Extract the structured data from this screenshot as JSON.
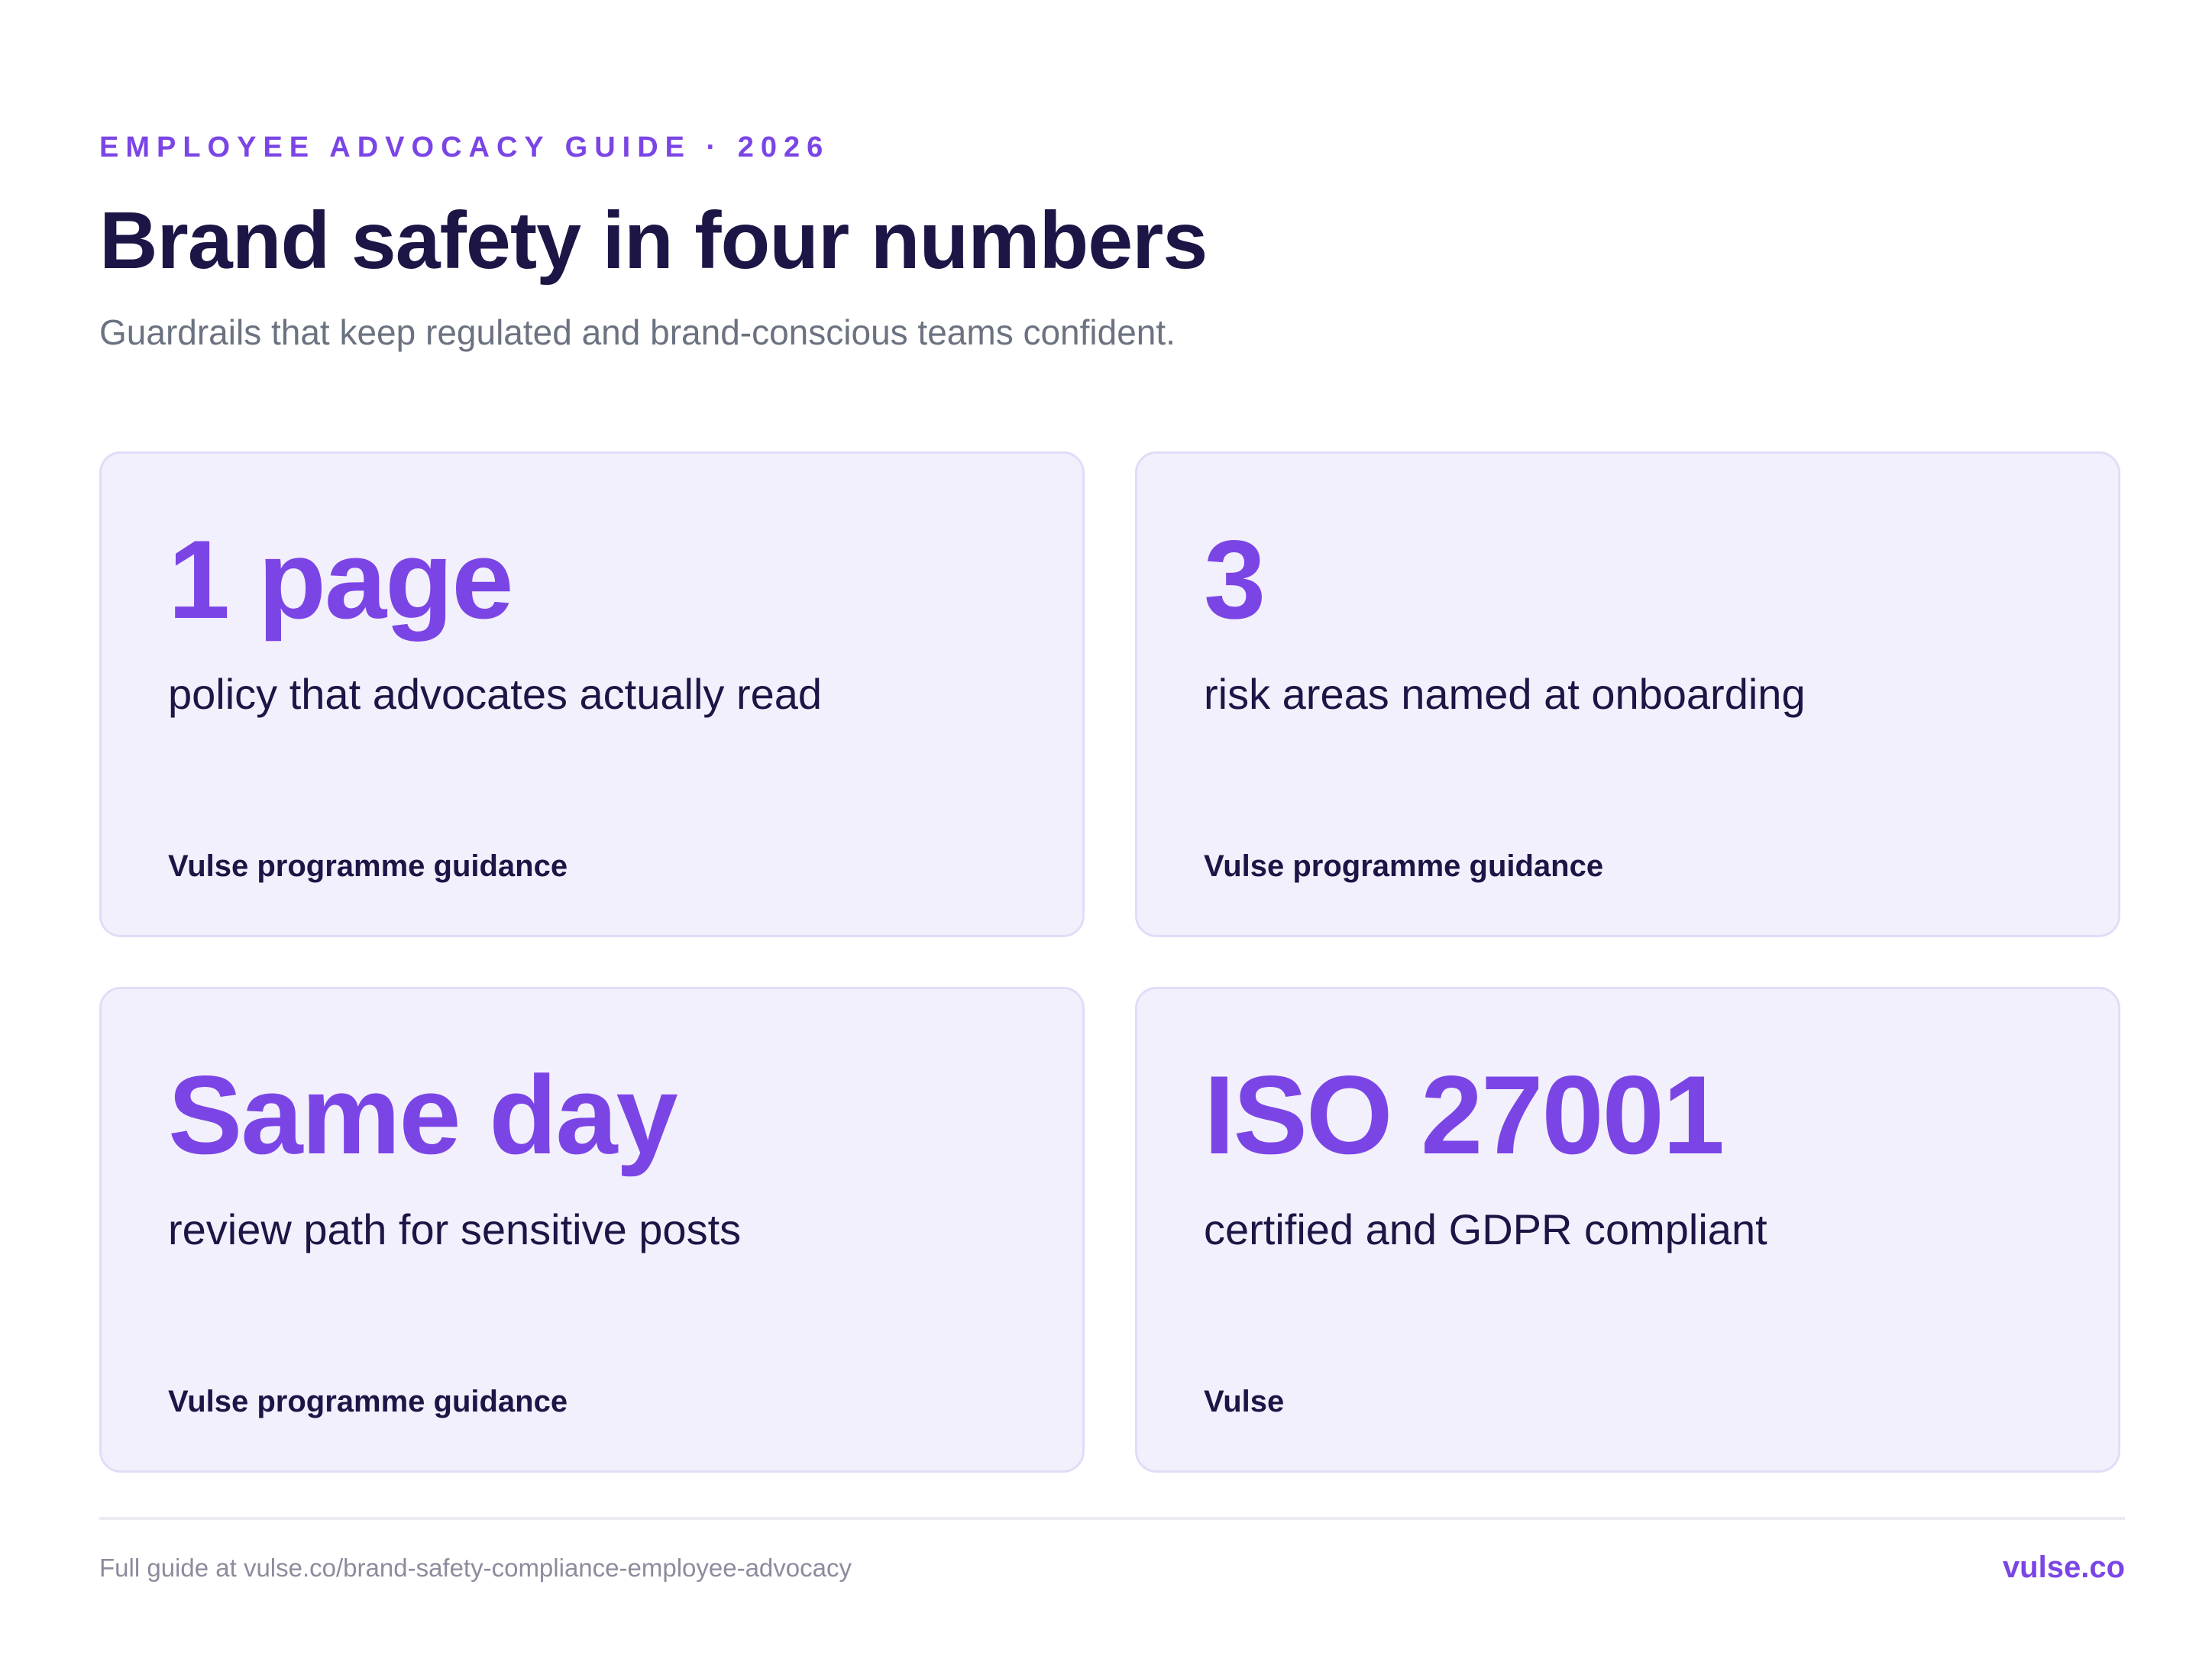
{
  "header": {
    "eyebrow": "EMPLOYEE ADVOCACY GUIDE · 2026",
    "title": "Brand safety in four numbers",
    "subtitle": "Guardrails that keep regulated and brand-conscious teams confident."
  },
  "stats": [
    {
      "value": "1 page",
      "description": "policy that advocates actually read",
      "source": "Vulse programme guidance"
    },
    {
      "value": "3",
      "description": "risk areas named at onboarding",
      "source": "Vulse programme guidance"
    },
    {
      "value": "Same day",
      "description": "review path for sensitive posts",
      "source": "Vulse programme guidance"
    },
    {
      "value": "ISO 27001",
      "description": "certified and GDPR compliant",
      "source": "Vulse"
    }
  ],
  "footer": {
    "link_text": "Full guide at vulse.co/brand-safety-compliance-employee-advocacy",
    "brand": "vulse.co"
  },
  "colors": {
    "accent": "#7b45e6",
    "heading": "#1c1646",
    "card_background": "#f2f0fc",
    "card_border": "#e2dcf8",
    "muted_text": "#6b7280"
  }
}
